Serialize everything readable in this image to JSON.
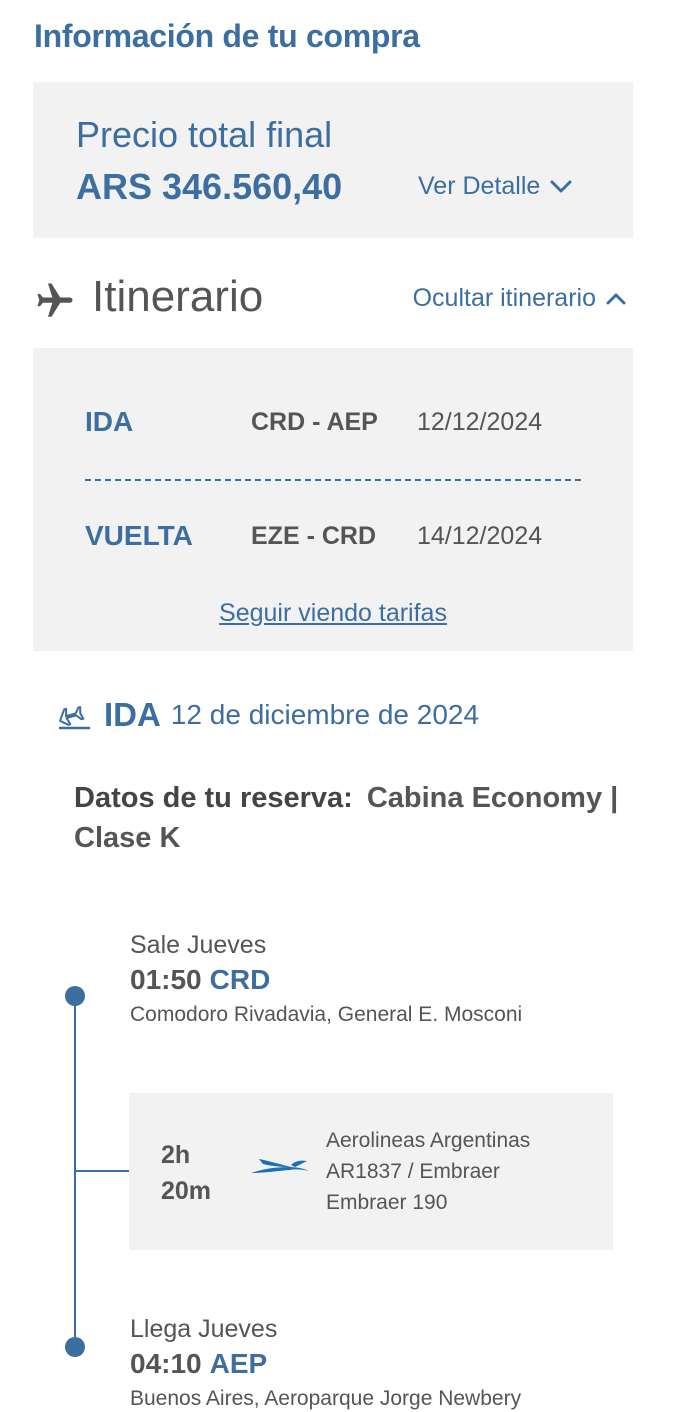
{
  "purchase": {
    "title": "Información de tu compra",
    "price_label": "Precio total final",
    "price_value": "ARS 346.560,40",
    "detail_link": "Ver Detalle"
  },
  "itinerary": {
    "title": "Itinerario",
    "hide_link": "Ocultar itinerario",
    "legs": [
      {
        "type": "IDA",
        "route": "CRD - AEP",
        "date": "12/12/2024"
      },
      {
        "type": "VUELTA",
        "route": "EZE - CRD",
        "date": "14/12/2024"
      }
    ],
    "more_fares_link": "Seguir viendo tarifas"
  },
  "outbound": {
    "label": "IDA",
    "date": "12 de diciembre de 2024",
    "booking_label": "Datos de tu reserva:",
    "booking_value": "Cabina Economy | Clase K",
    "departure": {
      "day": "Sale Jueves",
      "time": "01:50",
      "code": "CRD",
      "place": "Comodoro Rivadavia, General E. Mosconi"
    },
    "flight": {
      "duration_h": "2h",
      "duration_m": "20m",
      "airline": "Aerolineas Argentinas",
      "number": "AR1837 / Embraer",
      "aircraft": "Embraer 190"
    },
    "arrival": {
      "day": "Llega Jueves",
      "time": "04:10",
      "code": "AEP",
      "place": "Buenos Aires, Aeroparque Jorge Newbery"
    }
  },
  "colors": {
    "brand_blue": "#3c6ea0",
    "card_gray": "#f2f2f2",
    "text_gray": "#555555"
  },
  "icons": {
    "chevron_down": "chevron-down-icon",
    "chevron_up": "chevron-up-icon",
    "plane": "airplane-icon",
    "departure": "flight-departure-icon",
    "airline_logo": "aerolineas-argentinas-logo"
  }
}
